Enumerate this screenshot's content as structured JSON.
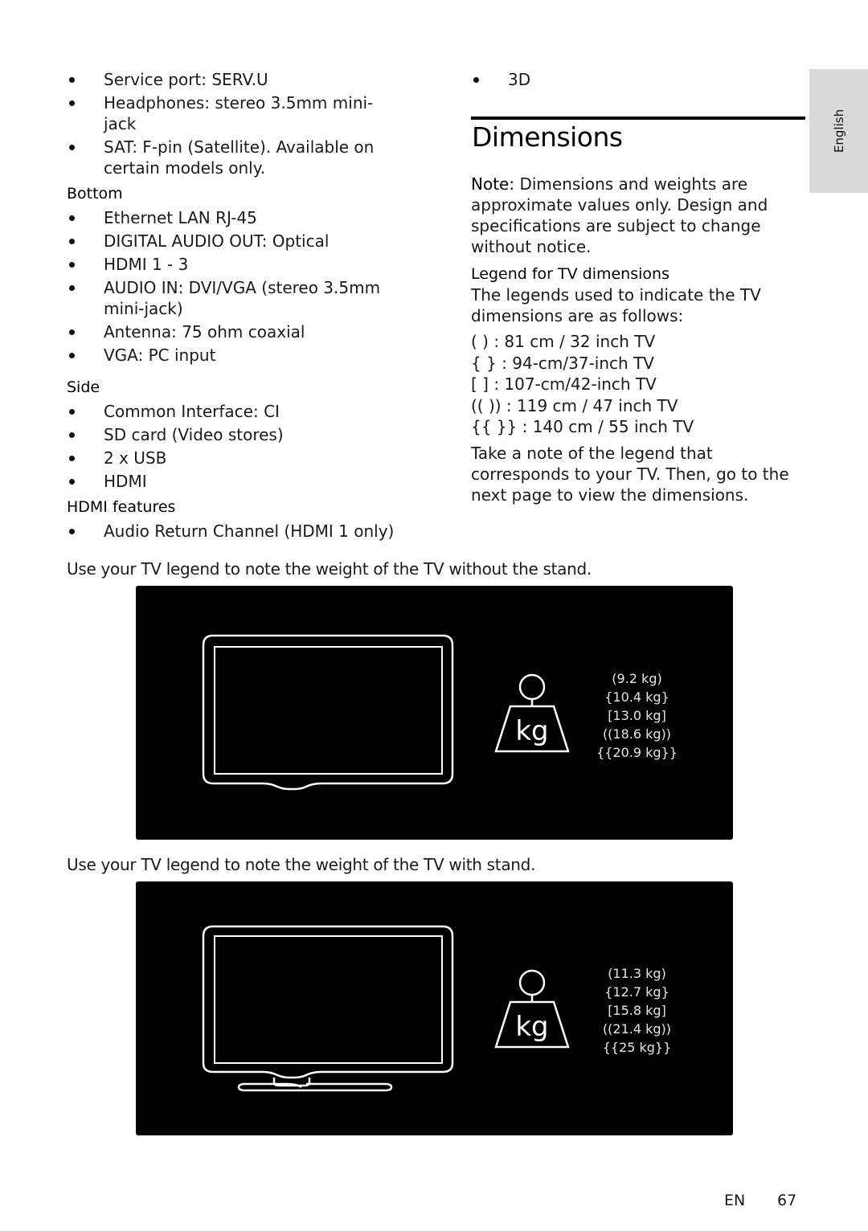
{
  "left_column": {
    "top_items": [
      "Service port: SERV.U",
      "Headphones: stereo 3.5mm mini-jack",
      "SAT: F-pin (Satellite). Available on certain models only."
    ],
    "bottom": {
      "heading": "Bottom",
      "items": [
        "Ethernet LAN RJ-45",
        "DIGITAL AUDIO OUT: Optical",
        "HDMI 1 - 3",
        "AUDIO IN: DVI/VGA (stereo 3.5mm mini-jack)",
        "Antenna: 75 ohm coaxial",
        "VGA: PC input"
      ]
    },
    "side": {
      "heading": "Side",
      "items": [
        "Common Interface: CI",
        "SD card (Video stores)",
        "2 x USB",
        "HDMI"
      ]
    },
    "hdmi_features": {
      "heading": "HDMI features",
      "items": [
        "Audio Return Channel (HDMI 1 only)"
      ]
    }
  },
  "right_column": {
    "top_items": [
      "3D"
    ],
    "section_title": "Dimensions",
    "note_label": "Note:",
    "note_text": " Dimensions and weights are approximate values only. Design and specifications are subject to change without notice.",
    "legend_heading": "Legend for TV dimensions",
    "legend_intro": "The legends used to indicate the TV dimensions are as follows:",
    "legend_items": [
      "( ) : 81 cm / 32 inch TV",
      "{ } : 94-cm/37-inch TV",
      "[ ] : 107-cm/42-inch TV",
      "(( )) : 119 cm / 47 inch TV",
      "{{ }} : 140 cm / 55 inch TV"
    ],
    "closing_text": "Take a note of the legend that corresponds to your TV. Then, go to the next page to view the dimensions."
  },
  "language_tab": "English",
  "figures": [
    {
      "caption": "Use your TV legend to note the weight of the TV without the stand.",
      "weight_icon_label": "kg",
      "with_stand": false,
      "weights": [
        "(9.2 kg)",
        "{10.4 kg}",
        "[13.0 kg]",
        "((18.6 kg))",
        "{{20.9 kg}}"
      ]
    },
    {
      "caption": "Use your TV legend to note the weight of the TV with stand.",
      "weight_icon_label": "kg",
      "with_stand": true,
      "weights": [
        "(11.3 kg)",
        "{12.7 kg}",
        "[15.8 kg]",
        "((21.4 kg))",
        "{{25 kg}}"
      ]
    }
  ],
  "footer": {
    "language_code": "EN",
    "page_number": "67"
  }
}
